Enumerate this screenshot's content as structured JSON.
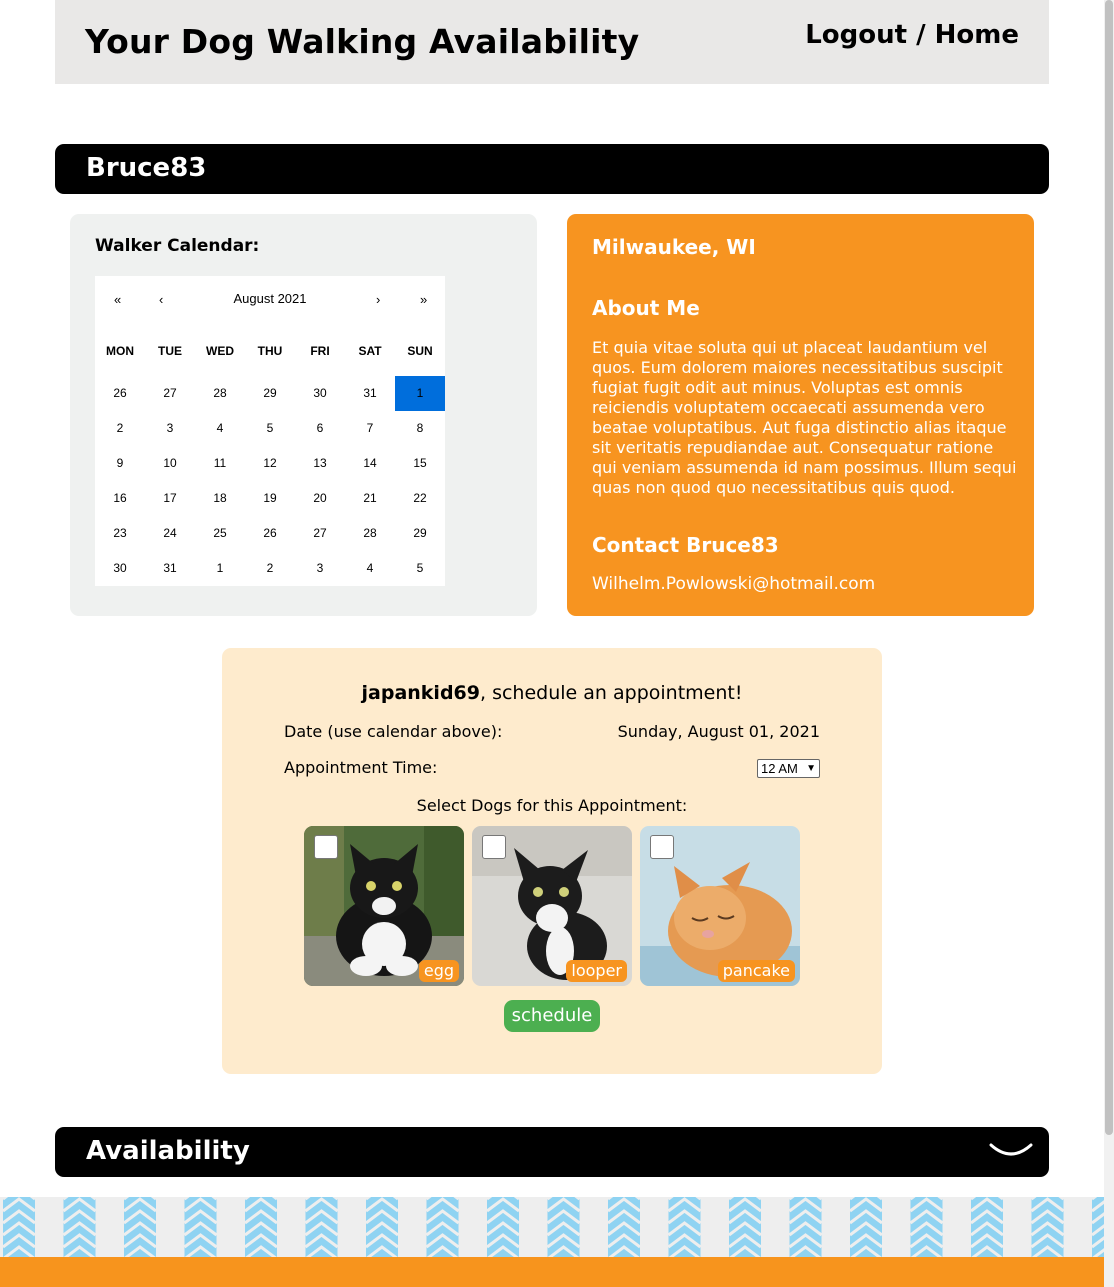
{
  "header": {
    "title": "Your Dog Walking Availability",
    "logout": "Logout",
    "separator": " / ",
    "home": "Home"
  },
  "walker": {
    "username": "Bruce83",
    "calendar_label": "Walker Calendar:",
    "location": "Milwaukee, WI",
    "about_heading": "About Me",
    "about_text": "Et quia vitae soluta qui ut placeat laudantium vel quos. Eum dolorem maiores necessitatibus suscipit fugiat fugit odit aut minus. Voluptas est omnis reiciendis voluptatem occaecati assumenda vero beatae voluptatibus. Aut fuga distinctio alias itaque sit veritatis repudiandae aut. Consequatur ratione qui veniam assumenda id nam possimus. Illum sequi quas non quod quo necessitatibus quis quod.",
    "contact_heading": "Contact Bruce83",
    "email": "Wilhelm.Powlowski@hotmail.com"
  },
  "calendar": {
    "month_label": "August 2021",
    "nav": {
      "prev_year": "«",
      "prev_month": "‹",
      "next_month": "›",
      "next_year": "»"
    },
    "weekdays": [
      "MON",
      "TUE",
      "WED",
      "THU",
      "FRI",
      "SAT",
      "SUN"
    ],
    "weeks": [
      [
        "26",
        "27",
        "28",
        "29",
        "30",
        "31",
        "1"
      ],
      [
        "2",
        "3",
        "4",
        "5",
        "6",
        "7",
        "8"
      ],
      [
        "9",
        "10",
        "11",
        "12",
        "13",
        "14",
        "15"
      ],
      [
        "16",
        "17",
        "18",
        "19",
        "20",
        "21",
        "22"
      ],
      [
        "23",
        "24",
        "25",
        "26",
        "27",
        "28",
        "29"
      ],
      [
        "30",
        "31",
        "1",
        "2",
        "3",
        "4",
        "5"
      ]
    ],
    "selected_day": "1",
    "selected_color": "#006edc"
  },
  "appointment": {
    "user": "japankid69",
    "greeting_suffix": ", schedule an appointment!",
    "date_label": "Date (use calendar above):",
    "date_value": "Sunday, August 01, 2021",
    "time_label": "Appointment Time:",
    "time_value": "12 AM",
    "select_label": "Select Dogs for this Appointment:",
    "pets": [
      {
        "name": "egg",
        "checked": false
      },
      {
        "name": "looper",
        "checked": false
      },
      {
        "name": "pancake",
        "checked": false
      }
    ],
    "schedule_button": "schedule"
  },
  "availability": {
    "title": "Availability",
    "toggle_icon": "chevron-down-icon"
  },
  "colors": {
    "accent_orange": "#f79420",
    "appointment_bg": "#feebcd",
    "schedule_green": "#4caf50",
    "header_bg": "#e9e8e7"
  }
}
